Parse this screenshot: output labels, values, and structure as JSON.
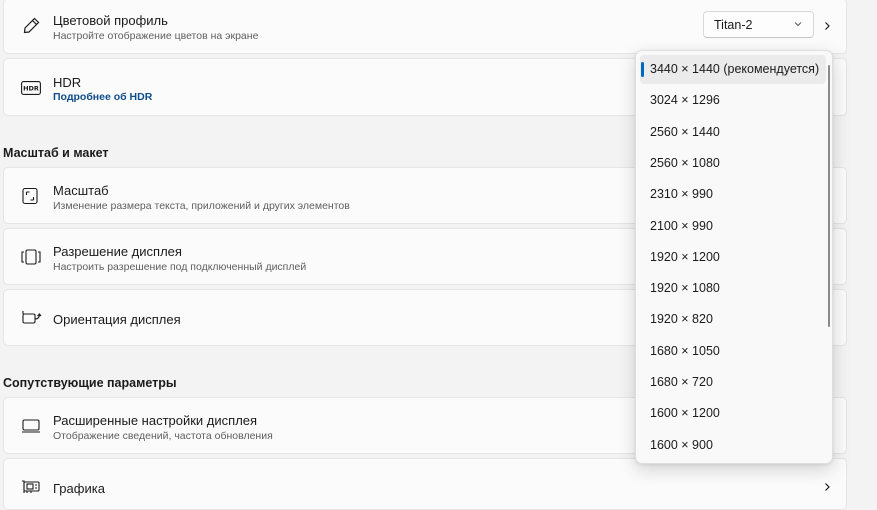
{
  "cards": {
    "color_profile": {
      "title": "Цветовой профиль",
      "subtitle": "Настройте отображение цветов на экране",
      "value": "Titan-2"
    },
    "hdr": {
      "title": "HDR",
      "link": "Подробнее об HDR",
      "icon_text": "HDR"
    },
    "scale": {
      "title": "Масштаб",
      "subtitle": "Изменение размера текста, приложений и других элементов"
    },
    "resolution": {
      "title": "Разрешение дисплея",
      "subtitle": "Настроить разрешение под подключенный дисплей"
    },
    "orientation": {
      "title": "Ориентация дисплея"
    },
    "advanced_display": {
      "title": "Расширенные настройки дисплея",
      "subtitle": "Отображение сведений, частота обновления"
    },
    "graphics": {
      "title": "Графика"
    }
  },
  "sections": {
    "scale_layout": "Масштаб и макет",
    "related": "Сопутствующие параметры"
  },
  "resolution_dropdown": {
    "options": [
      "3440 × 1440 (рекомендуется)",
      "3024 × 1296",
      "2560 × 1440",
      "2560 × 1080",
      "2310 × 990",
      "2100 × 990",
      "1920 × 1200",
      "1920 × 1080",
      "1920 × 820",
      "1680 × 1050",
      "1680 × 720",
      "1600 × 1200",
      "1600 × 900"
    ],
    "selected_index": 0
  },
  "colors": {
    "accent": "#0067c0",
    "link": "#0f4d8a"
  }
}
